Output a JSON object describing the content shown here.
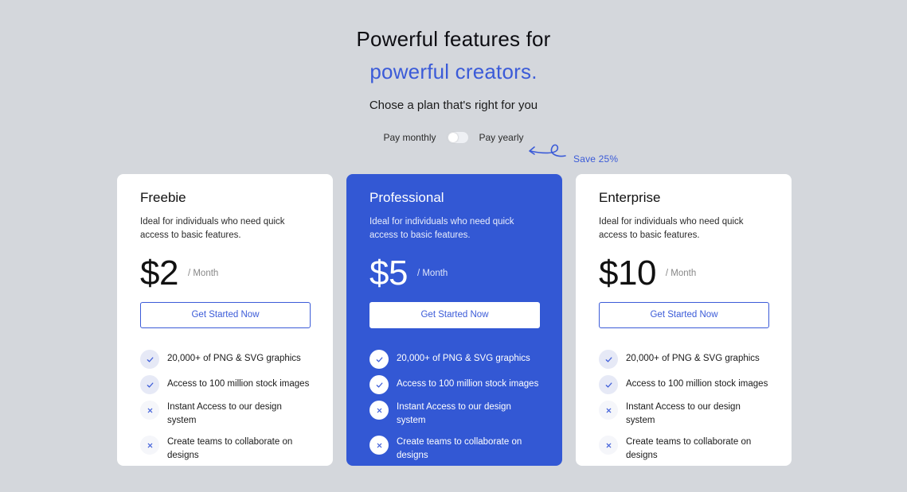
{
  "hero": {
    "title_line1": "Powerful features for",
    "title_line2": "powerful creators.",
    "subtitle": "Chose a plan that's right for you"
  },
  "billing": {
    "monthly_label": "Pay monthly",
    "yearly_label": "Pay yearly",
    "yearly_selected": false,
    "save_label": "Save 25%"
  },
  "colors": {
    "accent": "#3b5bd8",
    "featured_card": "#3358d4",
    "background": "#d4d7dc"
  },
  "plans": [
    {
      "name": "Freebie",
      "description": "Ideal for individuals who need quick access to basic features.",
      "price": "$2",
      "period": "/  Month",
      "cta": "Get Started Now",
      "featured": false,
      "features": [
        {
          "text": "20,000+ of PNG & SVG graphics",
          "included": true,
          "icon": "check-icon"
        },
        {
          "text": "Access to 100 million stock images",
          "included": true,
          "icon": "check-icon"
        },
        {
          "text": "Instant Access to our design system",
          "included": false,
          "icon": "cross-icon"
        },
        {
          "text": "Create teams to collaborate on designs",
          "included": false,
          "icon": "cross-icon"
        }
      ]
    },
    {
      "name": "Professional",
      "description": "Ideal for individuals who need quick access to basic features.",
      "price": "$5",
      "period": "/  Month",
      "cta": "Get Started Now",
      "featured": true,
      "features": [
        {
          "text": "20,000+ of PNG & SVG graphics",
          "included": true,
          "icon": "check-icon"
        },
        {
          "text": "Access to 100 million stock images",
          "included": true,
          "icon": "check-icon"
        },
        {
          "text": "Instant Access to our design system",
          "included": false,
          "icon": "cross-icon"
        },
        {
          "text": "Create teams to collaborate on designs",
          "included": false,
          "icon": "cross-icon"
        }
      ]
    },
    {
      "name": "Enterprise",
      "description": "Ideal for individuals who need quick access to basic features.",
      "price": "$10",
      "period": "/  Month",
      "cta": "Get Started Now",
      "featured": false,
      "features": [
        {
          "text": "20,000+ of PNG & SVG graphics",
          "included": true,
          "icon": "check-icon"
        },
        {
          "text": "Access to 100 million stock images",
          "included": true,
          "icon": "check-icon"
        },
        {
          "text": "Instant Access to our design system",
          "included": false,
          "icon": "cross-icon"
        },
        {
          "text": "Create teams to collaborate on designs",
          "included": false,
          "icon": "cross-icon"
        }
      ]
    }
  ]
}
